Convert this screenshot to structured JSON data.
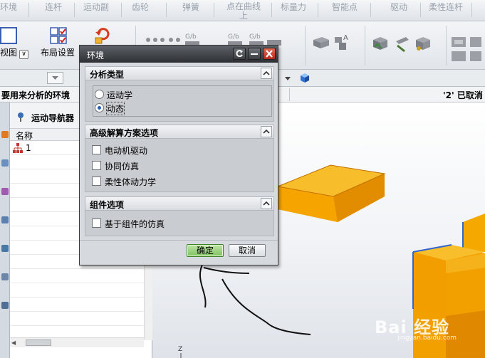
{
  "menu": {
    "items": [
      "环境",
      "连杆",
      "运动副",
      "齿轮",
      "弹簧",
      "点在曲线上",
      "标量力",
      "智能点",
      "驱动",
      "柔性连杆"
    ]
  },
  "toolbar": {
    "view_label": "视图",
    "view_chevron": "∨",
    "layout_label": "布局设置"
  },
  "statusbar": {
    "left_text": "要用来分析的环境",
    "right_text": "'2' 已取消"
  },
  "navigator": {
    "title": "运动导航器",
    "column_name": "名称",
    "rows": [
      {
        "label": "1"
      }
    ]
  },
  "dialog": {
    "title": "环境",
    "groups": {
      "analysis_type": {
        "title": "分析类型",
        "options": [
          {
            "label": "运动学",
            "selected": false
          },
          {
            "label": "动态",
            "selected": true
          }
        ]
      },
      "advanced_solver": {
        "title": "高级解算方案选项",
        "options": [
          {
            "label": "电动机驱动",
            "checked": false
          },
          {
            "label": "协同仿真",
            "checked": false
          },
          {
            "label": "柔性体动力学",
            "checked": false
          }
        ]
      },
      "component": {
        "title": "组件选项",
        "options": [
          {
            "label": "基于组件的仿真",
            "checked": false
          }
        ]
      }
    },
    "ok_label": "确定",
    "cancel_label": "取消"
  },
  "graphics": {
    "axis_label": "Z",
    "watermark": "Bai 经验",
    "watermark_sub": "jingyan.baidu.com",
    "model_color": "#f5a800"
  }
}
